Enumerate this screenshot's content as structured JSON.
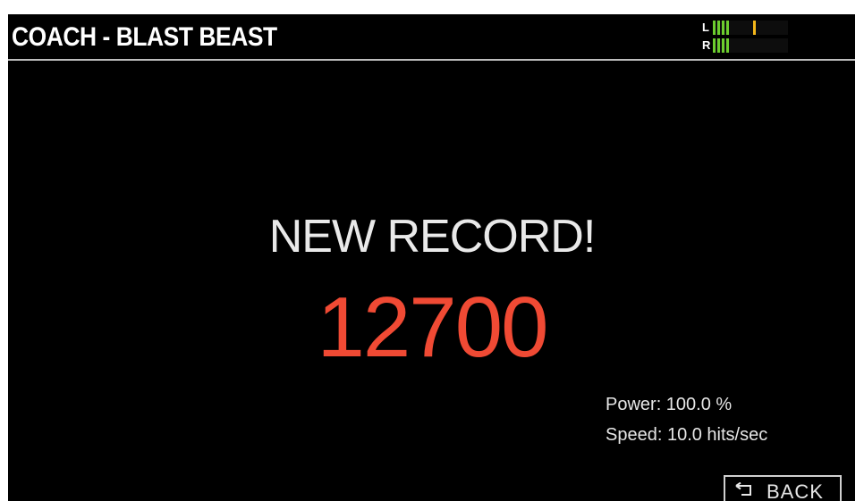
{
  "header": {
    "title": "COACH - BLAST BEAST"
  },
  "level_meter": {
    "left_label": "L",
    "right_label": "R",
    "left_level_segments": 4,
    "right_level_segments": 4,
    "left_peak_hold": true,
    "segment_color": "#6ccd2e",
    "peak_color": "#f4b71a"
  },
  "result": {
    "headline": "NEW RECORD!",
    "score": "12700",
    "score_color": "#f04a34"
  },
  "stats": {
    "power": "Power: 100.0 %",
    "speed": "Speed: 10.0 hits/sec"
  },
  "footer": {
    "back_label": "BACK",
    "back_icon": "return-arrow-icon"
  }
}
